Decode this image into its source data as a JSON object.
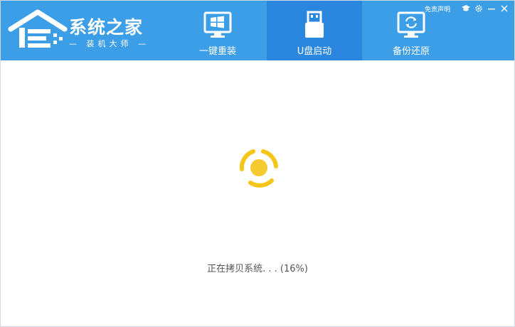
{
  "logo": {
    "title": "系统之家",
    "subtitle": "— 装机大师 —"
  },
  "nav": {
    "tabs": [
      {
        "label": "一键重装",
        "icon": "windows-monitor-icon"
      },
      {
        "label": "U盘启动",
        "icon": "usb-drive-icon",
        "active": true
      },
      {
        "label": "备份还原",
        "icon": "restore-monitor-icon"
      }
    ]
  },
  "top_bar": {
    "disclaimer": "免责声明",
    "icons": [
      "graduation-cap-icon",
      "settings-icon",
      "minimize-icon",
      "close-icon"
    ]
  },
  "status": {
    "message": "正在拷贝系统. . . (16%)"
  },
  "colors": {
    "header": "#3d9ee8",
    "active_tab": "#2a86de",
    "spinner": "#f5c518"
  }
}
